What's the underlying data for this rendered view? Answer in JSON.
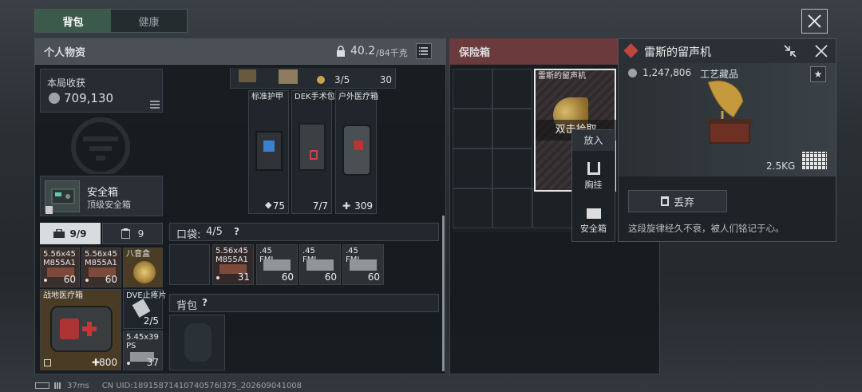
{
  "tabs": [
    {
      "label": "背包"
    },
    {
      "label": "健康"
    }
  ],
  "personal": {
    "title": "个人物资",
    "weight": "40.2",
    "weight_max": "/84千克"
  },
  "earnings": {
    "label": "本局收获",
    "value": "709,130"
  },
  "safe_box": {
    "title": "安全箱",
    "subtitle": "顶级安全箱"
  },
  "storage_tabs": [
    {
      "label": "9/9"
    },
    {
      "label": "9"
    }
  ],
  "top_counts": {
    "a": "3/5",
    "b": "30"
  },
  "gear": [
    {
      "label": "标准护甲",
      "count": "75"
    },
    {
      "label": "DEK手术包",
      "count": "7/7"
    },
    {
      "label": "户外医疗箱",
      "count": "309"
    }
  ],
  "pocket": {
    "label": "口袋:",
    "count": "4/5",
    "help": "?"
  },
  "pocket_items": [
    {
      "label": "5.56x45\nM855A1",
      "count": "31"
    },
    {
      "label": ".45\nFMJ",
      "count": "60"
    },
    {
      "label": ".45\nFMJ",
      "count": "60"
    },
    {
      "label": ".45\nFMJ",
      "count": "60"
    }
  ],
  "backpack": {
    "label": "背包",
    "help": "?"
  },
  "safe_items": [
    {
      "label": "5.56x45\nM855A1",
      "count": "60"
    },
    {
      "label": "5.56x45\nM855A1",
      "count": "60"
    },
    {
      "label": "八音盒",
      "count": ""
    },
    {
      "label": "战地医疗箱",
      "count": "800"
    },
    {
      "label": "DVE止疼片",
      "count": "2/5"
    },
    {
      "label": "5.45x39\nPS",
      "count": "37"
    }
  ],
  "vault": {
    "title": "保险箱",
    "item_label": "雷斯的留声机",
    "pickup": "双击拾取"
  },
  "context_menu": {
    "put": "放入",
    "chest": "胸挂",
    "safebox": "安全箱"
  },
  "detail": {
    "title": "雷斯的留声机",
    "price": "1,247,806",
    "category": "工艺藏品",
    "weight": "2.5KG",
    "discard": "丢弃",
    "desc": "这段旋律经久不衰，被人们铭记于心。"
  },
  "status": {
    "ping": "37ms",
    "uid": "CN UID:18915871410740576l375_202609041008"
  },
  "colors": {
    "accent_red": "#8e2f2f",
    "gold": "#c7a44a",
    "green_tab": "#2f4f3f"
  }
}
